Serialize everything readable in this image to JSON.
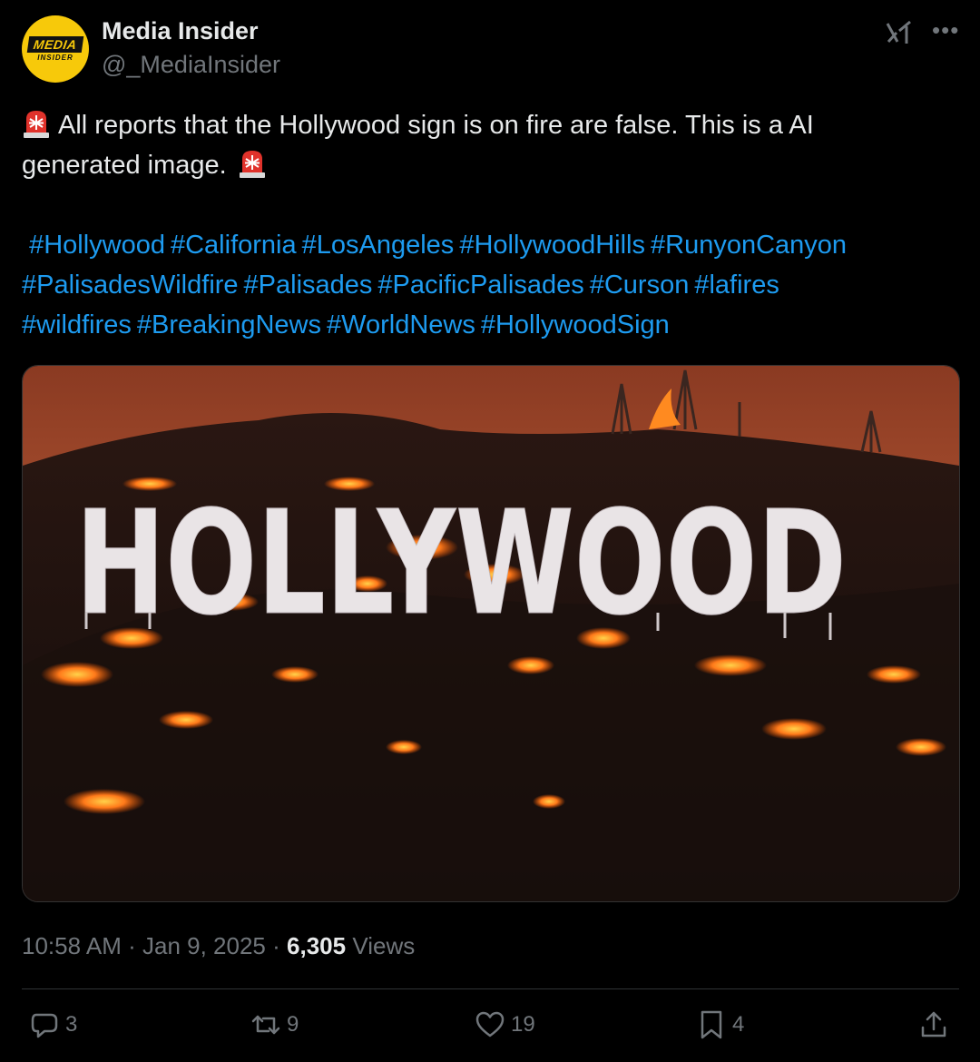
{
  "author": {
    "name": "Media Insider",
    "handle": "@_MediaInsider",
    "avatar_logo_top": "MEDIA",
    "avatar_logo_bottom": "INSIDER"
  },
  "icons": {
    "grok": "grok-icon",
    "more": "more-icon",
    "emoji": "police-light-emoji"
  },
  "post": {
    "text_line1": "All reports that the Hollywood sign is on fire are false. This is a AI",
    "text_line2": "generated image.",
    "hashtags": [
      "#Hollywood",
      "#California",
      "#LosAngeles",
      "#HollywoodHills",
      "#RunyonCanyon",
      "#PalisadesWildfire",
      "#Palisades",
      "#PacificPalisades",
      "#Curson",
      "#lafires",
      "#wildfires",
      "#BreakingNews",
      "#WorldNews",
      "#HollywoodSign"
    ],
    "image_sign_text": "HOLLYWOOD"
  },
  "meta": {
    "time": "10:58 AM",
    "sep1": "·",
    "date": "Jan 9, 2025",
    "sep2": "·",
    "views_count": "6,305",
    "views_label": "Views"
  },
  "actions": {
    "replies": "3",
    "reposts": "9",
    "likes": "19",
    "bookmarks": "4"
  },
  "colors": {
    "background": "#000000",
    "text": "#e7e9ea",
    "muted": "#71767b",
    "link": "#1d9bf0",
    "avatar": "#f7c90a"
  }
}
